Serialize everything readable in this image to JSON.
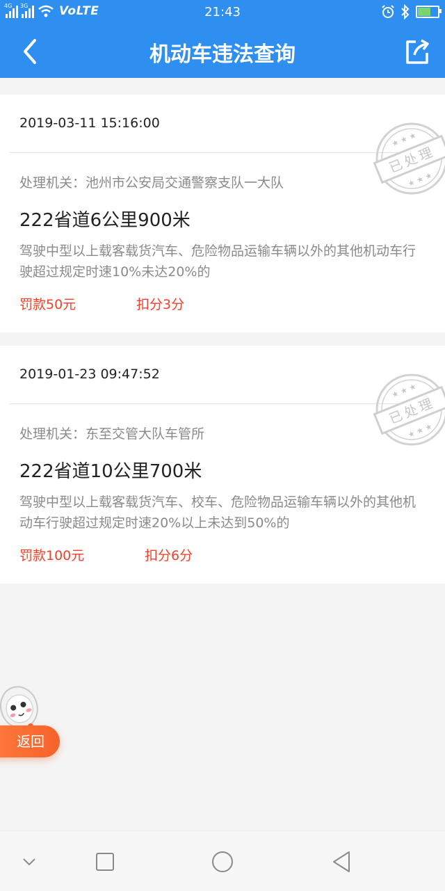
{
  "status_bar": {
    "signal_1_label": "4G",
    "signal_2_label": "3G",
    "network_label": "VoLTE",
    "time": "21:43",
    "icons": [
      "signal-icon",
      "signal-icon",
      "wifi-icon",
      "alarm-icon",
      "bluetooth-icon",
      "battery-icon"
    ]
  },
  "header": {
    "title": "机动车违法查询",
    "back_icon": "chevron-left-icon",
    "share_icon": "share-icon"
  },
  "violations": [
    {
      "time": "2019-03-11 15:16:00",
      "authority": "处理机关：池州市公安局交通警察支队一大队",
      "location": "222省道6公里900米",
      "description": "驾驶中型以上载客载货汽车、危险物品运输车辆以外的其他机动车行驶超过规定时速10%未达20%的",
      "fine": "罚款50元",
      "points": "扣分3分",
      "stamp_text": "已处理"
    },
    {
      "time": "2019-01-23 09:47:52",
      "authority": "处理机关：东至交管大队车管所",
      "location": "222省道10公里700米",
      "description": "驾驶中型以上载客载货汽车、校车、危险物品运输车辆以外的其他机动车行驶超过规定时速20%以上未达到50%的",
      "fine": "罚款100元",
      "points": "扣分6分",
      "stamp_text": "已处理"
    }
  ],
  "floating": {
    "back_label": "返回",
    "mascot_icon": "robot-mascot-icon"
  },
  "nav_bar": {
    "icons": [
      "chevron-down-icon",
      "square-icon",
      "circle-icon",
      "triangle-back-icon"
    ]
  },
  "colors": {
    "primary": "#2f8ff0",
    "accent_red": "#f2412a",
    "back_pill": "#f6632c",
    "background": "#f4f4f4"
  }
}
